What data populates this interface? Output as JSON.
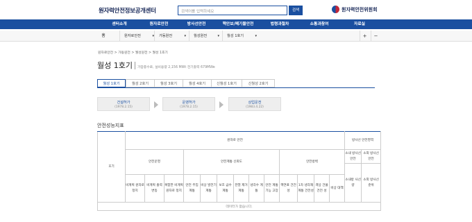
{
  "header": {
    "logo": "원자력안전정보공개센터",
    "search_placeholder": "검색어를 입력하세요",
    "search_button": "검색",
    "org": "원자력안전위원회"
  },
  "gnb": [
    "센터소개",
    "원자로안전",
    "방사선안전",
    "핵안보/폐기물안전",
    "법령과절차",
    "소통과참여",
    "자료실"
  ],
  "location": {
    "home": "홈",
    "selects": [
      "원자로안전",
      "가동원전",
      "월성원전",
      "월성 1호기"
    ],
    "plus": "+",
    "minus": "−"
  },
  "breadcrumb": "원자로안전 > 가동원전 > 월성원전 > 월성 1호기",
  "page": {
    "title": "월성 1호기",
    "subtitle": "가압중수로, 설비용량 2,156 MWt 전기출력 679MWe"
  },
  "tabs": [
    "월성 1호기",
    "월성 2호기",
    "월성 3호기",
    "월성 4호기",
    "신월성 1호기",
    "신월성 2호기"
  ],
  "steps": [
    {
      "label": "건설허가",
      "date": "(1978.2.15)"
    },
    {
      "label": "운영허가",
      "date": "(1978.2.15)"
    },
    {
      "label": "상업운전",
      "date": "(1983.4.22)"
    }
  ],
  "safety": {
    "title": "안전성능지표",
    "col_unit": "호기",
    "group_reactor": "원자로 안전",
    "group_radiation": "방사선 안전영역",
    "sub_op": "안전운영",
    "sub_sys": "안전계통 신뢰도",
    "sub_def": "안전방벽",
    "sub_worker": "소내 방사선 안전",
    "sub_public": "소외 방사선 안전",
    "cols": [
      "비계획 원자로 정지",
      "비계획 출력 변동",
      "복합한 비계획 원자로 정지",
      "안전 주입 계통",
      "비상 발전기 계통",
      "보조 급수 계통",
      "잔열 제거 계통",
      "냉각수 계통",
      "안전 계통 기능 고장",
      "핵연료 건전성",
      "1차 냉각재 계통 건전성",
      "격납 건물 건전 성",
      "비상 대책",
      "소내방 사선량",
      "소외 방사선 준위"
    ],
    "empty": "데이터가 없습니다."
  }
}
